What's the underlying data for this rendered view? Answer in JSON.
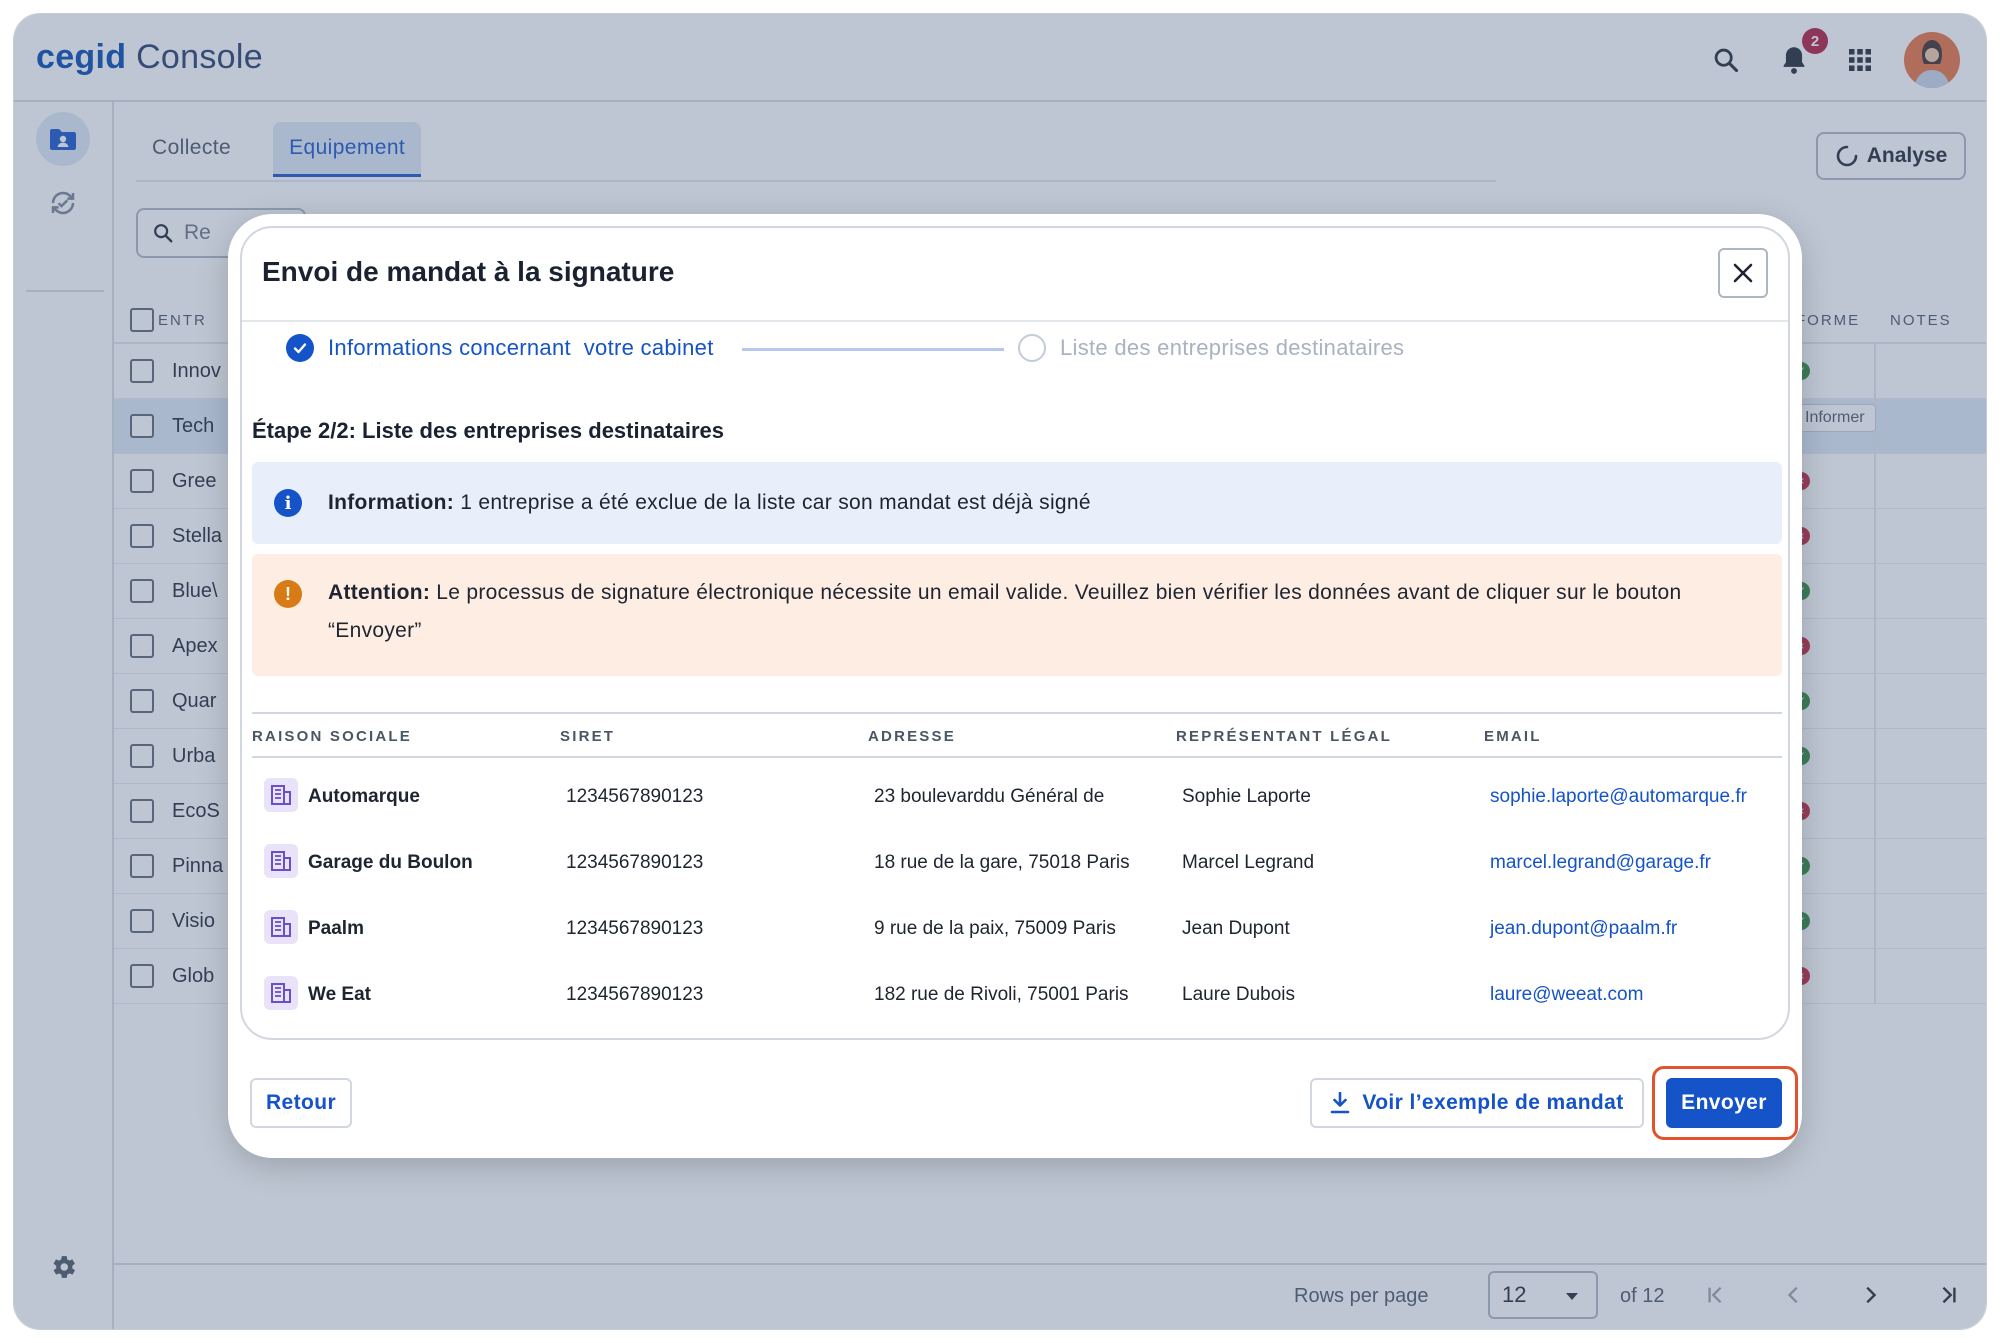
{
  "app": {
    "brand": "cegid",
    "product": "Console",
    "notification_count": "2"
  },
  "topbar": {
    "icons": [
      "search-icon",
      "bell-icon",
      "apps-grid-icon",
      "user-avatar"
    ]
  },
  "sidebar": {
    "items": [
      {
        "icon": "contact-folder-icon",
        "active": true
      },
      {
        "icon": "sync-check-icon",
        "active": false
      }
    ],
    "bottom_icon": "gear-icon"
  },
  "tabs": [
    {
      "label": "Collecte",
      "active": false
    },
    {
      "label": "Equipement",
      "active": true
    }
  ],
  "analyse_button": "Analyse",
  "search": {
    "partial_text": "Re"
  },
  "background_table": {
    "headers": {
      "first": "ENTR",
      "platform": "FORME",
      "notes": "NOTES"
    },
    "rows": [
      "Innov",
      "Tech",
      "Gree",
      "Stella",
      "Blue\\",
      "Apex",
      "Quar",
      "Urba",
      "EcoS",
      "Pinna",
      "Visio",
      "Glob"
    ],
    "statuses": [
      "ok",
      "informer",
      "error",
      "error",
      "ok",
      "error",
      "ok",
      "ok",
      "error",
      "ok",
      "ok",
      "error"
    ],
    "informer_label": "Informer"
  },
  "pagination": {
    "rows_per_page_label": "Rows per page",
    "rows_per_page_value": "12",
    "of_label": "of 12"
  },
  "modal": {
    "title": "Envoi de mandat à la signature",
    "steps": [
      {
        "label": "Informations concernant  votre cabinet",
        "done": true
      },
      {
        "label": "Liste des entreprises destinataires",
        "done": false
      }
    ],
    "step_heading": "Étape 2/2: Liste des entreprises destinataires",
    "info": {
      "label": "Information:",
      "text": " 1 entreprise a été exclue de la liste car son mandat est déjà signé"
    },
    "warning": {
      "label": "Attention:",
      "text": " Le processus de signature électronique nécessite un email valide. Veuillez bien vérifier les données avant de cliquer sur le bouton “Envoyer”"
    },
    "table": {
      "columns": [
        "RAISON SOCIALE",
        "SIRET",
        "ADRESSE",
        "REPRÉSENTANT LÉGAL",
        "EMAIL"
      ],
      "rows": [
        {
          "name": "Automarque",
          "siret": "1234567890123",
          "address": "23 boulevarddu Général de",
          "rep": "Sophie Laporte",
          "email": "sophie.laporte@automarque.fr"
        },
        {
          "name": "Garage du Boulon",
          "siret": "1234567890123",
          "address": "18 rue de la gare, 75018 Paris",
          "rep": "Marcel Legrand",
          "email": "marcel.legrand@garage.fr"
        },
        {
          "name": "Paalm",
          "siret": "1234567890123",
          "address": "9 rue de la paix, 75009 Paris",
          "rep": "Jean Dupont",
          "email": "jean.dupont@paalm.fr"
        },
        {
          "name": "We Eat",
          "siret": "1234567890123",
          "address": "182 rue de Rivoli, 75001 Paris",
          "rep": "Laure Dubois",
          "email": "laure@weeat.com"
        }
      ]
    },
    "buttons": {
      "back": "Retour",
      "example": "Voir l’exemple de mandat",
      "send": "Envoyer"
    }
  },
  "colors": {
    "primary": "#1553c8",
    "brand": "#0046ad",
    "warning": "#d87a16",
    "info_bg": "#e9eefb",
    "warning_bg": "#fdede3",
    "highlight_ring": "#e2532d"
  }
}
